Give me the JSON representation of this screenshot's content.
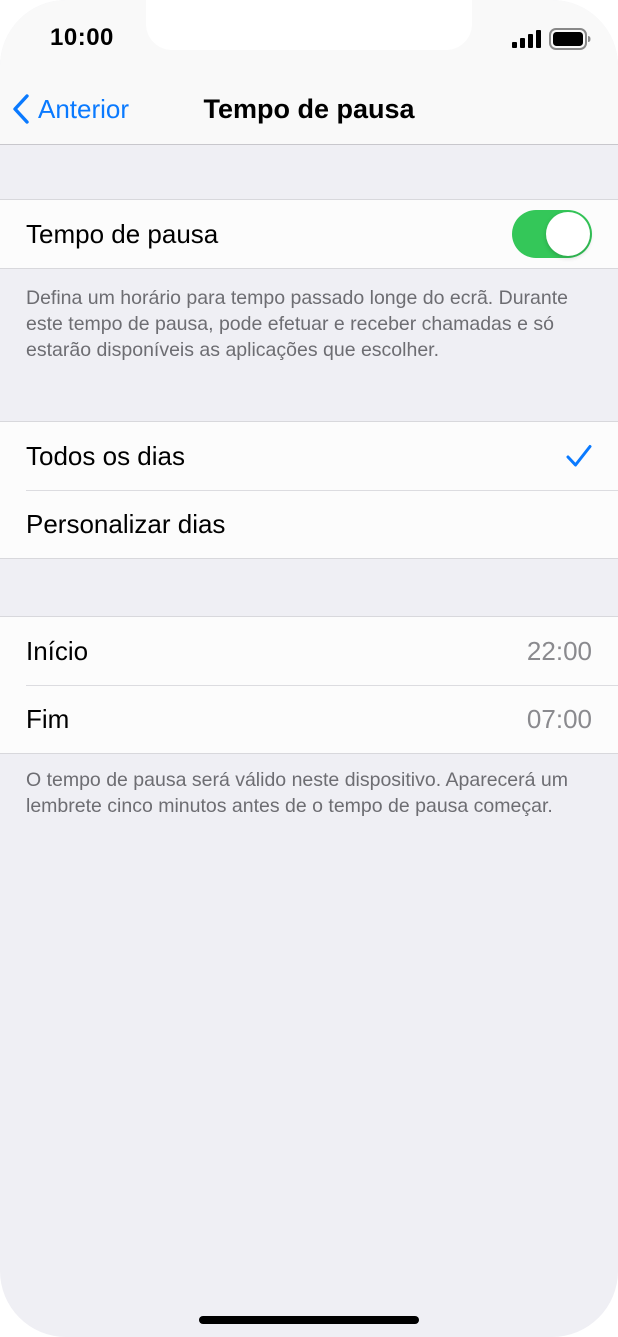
{
  "status_bar": {
    "time": "10:00",
    "signal_icon": "cellular-signal-icon",
    "battery_icon": "battery-icon"
  },
  "nav": {
    "back_label": "Anterior",
    "title": "Tempo de pausa"
  },
  "downtime": {
    "label": "Tempo de pausa",
    "enabled": true,
    "toggle_color": "#34c759",
    "description": "Defina um horário para tempo passado longe do ecrã. Durante este tempo de pausa, pode efetuar e receber chamadas e só estarão disponíveis as aplicações que escolher."
  },
  "days": {
    "items": [
      {
        "label": "Todos os dias",
        "selected": true
      },
      {
        "label": "Personalizar dias",
        "selected": false
      }
    ]
  },
  "schedule": {
    "start_label": "Início",
    "start_value": "22:00",
    "end_label": "Fim",
    "end_value": "07:00",
    "description": "O tempo de pausa será válido neste dispositivo. Aparecerá um lembrete cinco minutos antes de o tempo de pausa começar."
  },
  "colors": {
    "accent": "#0a7aff",
    "background": "#efeff4"
  }
}
